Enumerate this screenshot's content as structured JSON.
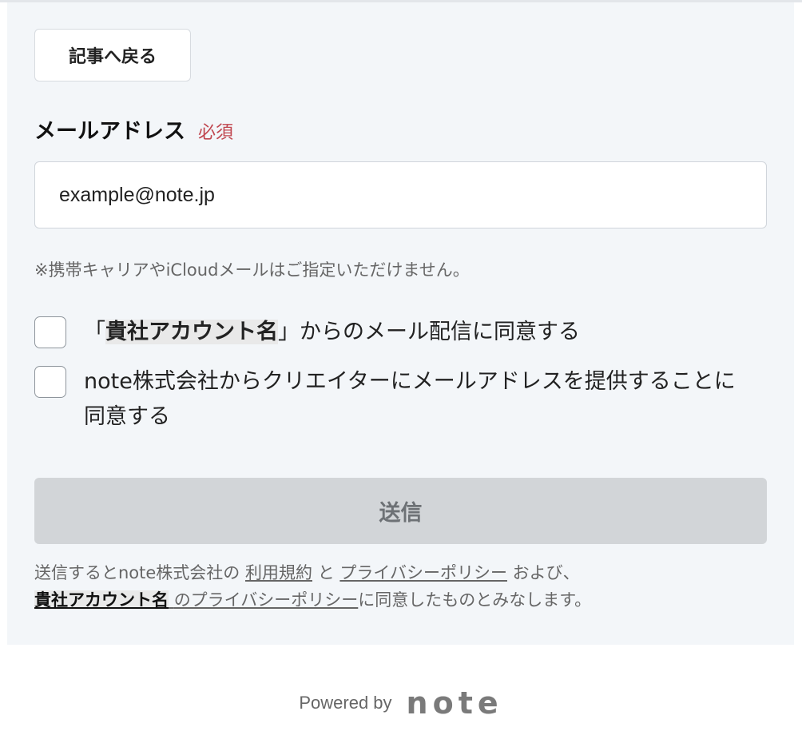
{
  "back_button": {
    "label": "記事へ戻る"
  },
  "email": {
    "label": "メールアドレス",
    "required": "必須",
    "value": "example@note.jp"
  },
  "note": "※携帯キャリアやiCloudメールはご指定いただけません。",
  "checkbox1": {
    "open_bracket": "「",
    "account": "貴社アカウント名",
    "rest": "」からのメール配信に同意する"
  },
  "checkbox2": {
    "label": "note株式会社からクリエイターにメールアドレスを提供することに同意する"
  },
  "submit": {
    "label": "送信"
  },
  "consent": {
    "prefix": "送信するとnote株式会社の",
    "terms": "利用規約",
    "and": "と",
    "privacy": "プライバシーポリシー",
    "and2": "および、",
    "account": "貴社アカウント名",
    "account_privacy": "のプライバシーポリシー",
    "suffix": "に同意したものとみなします。"
  },
  "footer": {
    "powered_by": "Powered by",
    "logo": "note"
  }
}
